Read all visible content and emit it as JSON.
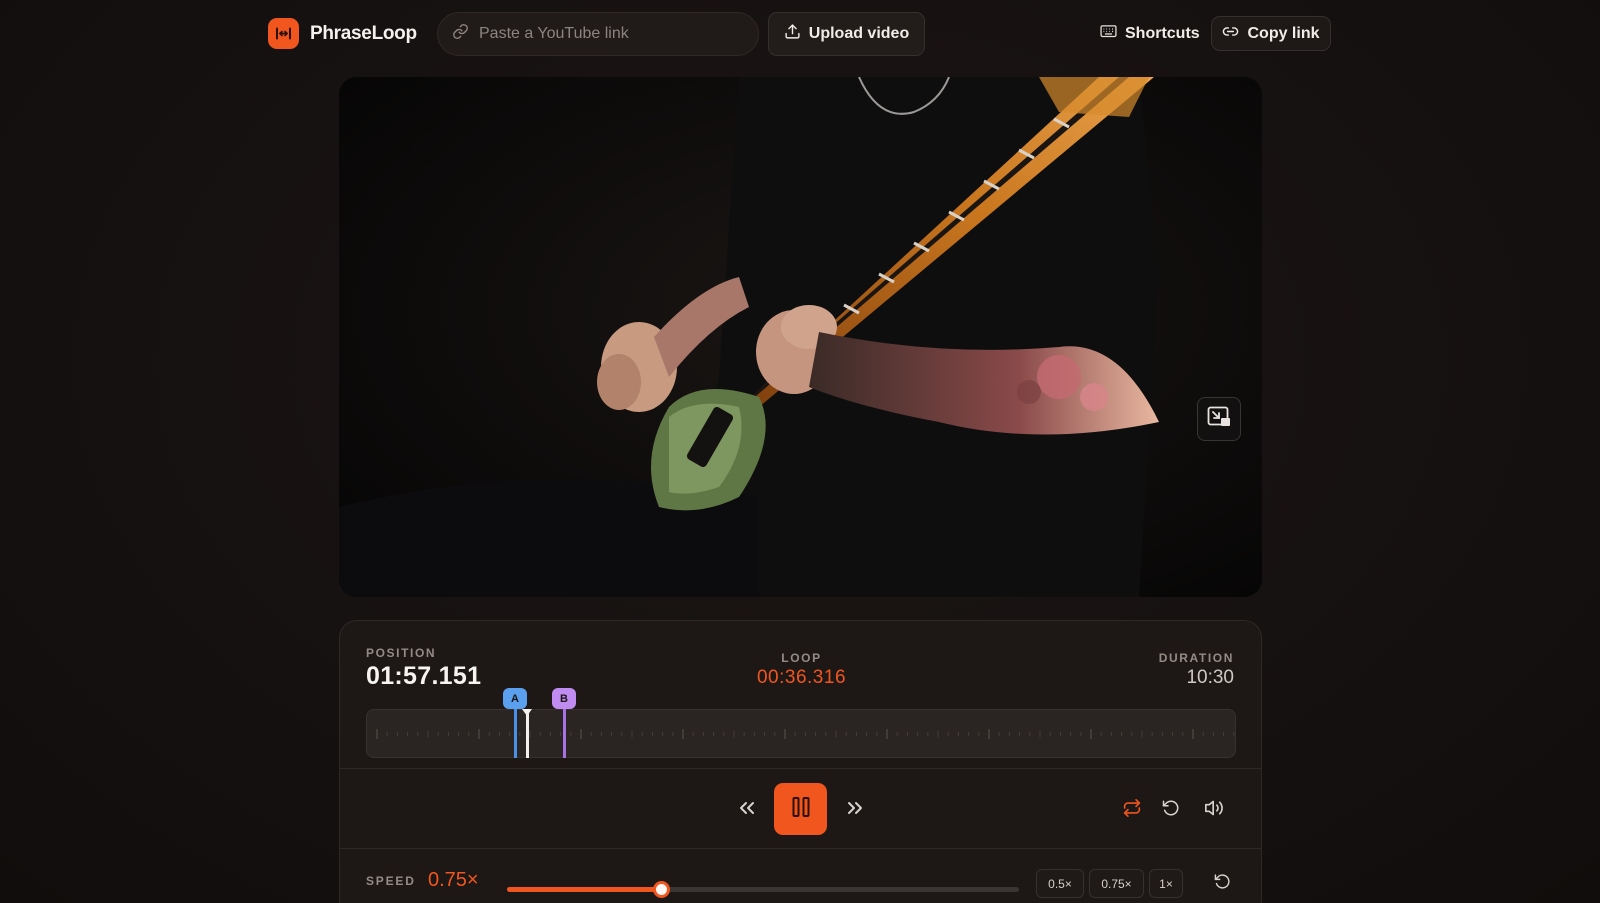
{
  "app": {
    "name": "PhraseLoop",
    "accent": "#f0561d"
  },
  "header": {
    "search_placeholder": "Paste a YouTube link",
    "upload_label": "Upload video",
    "shortcuts_label": "Shortcuts",
    "copy_link_label": "Copy link"
  },
  "stats": {
    "position_label": "POSITION",
    "position_value": "01:57.151",
    "loop_label": "LOOP",
    "loop_value": "00:36.316",
    "duration_label": "DURATION",
    "duration_value": "10:30"
  },
  "markers": {
    "a_label": "A",
    "b_label": "B",
    "a_color": "#4b90e8",
    "b_color": "#a872e6"
  },
  "transport": {
    "state": "playing",
    "icons": [
      "rewind-icon",
      "pause-icon",
      "fast-forward-icon",
      "loop-icon",
      "restart-icon",
      "volume-icon"
    ]
  },
  "speed": {
    "label": "SPEED",
    "value_label": "0.75×",
    "slider_fraction": 0.3,
    "presets": [
      "0.5×",
      "0.75×",
      "1×"
    ]
  }
}
